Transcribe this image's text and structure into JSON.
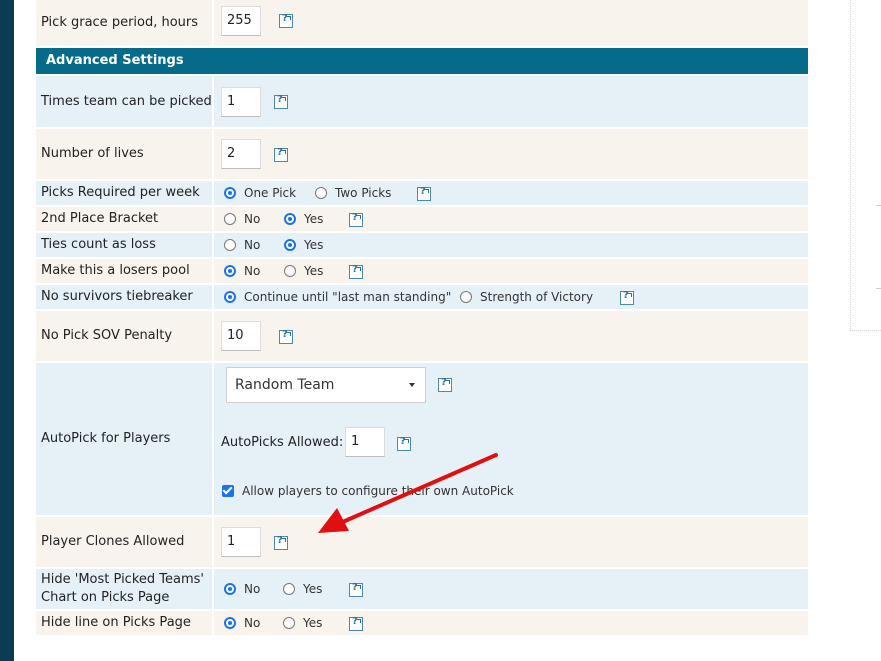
{
  "colors": {
    "section_header": "#066a8a",
    "left_bar": "#0c3c55",
    "row_beige": "#f8f3ec",
    "row_blue": "#e6f1f7",
    "radio_accent": "#1a73e8",
    "arrow": "#e01010"
  },
  "grace": {
    "label": "Pick grace period, hours",
    "value": "255"
  },
  "section": {
    "title": "Advanced Settings"
  },
  "times_picked": {
    "label": "Times team can be picked",
    "value": "1"
  },
  "lives": {
    "label": "Number of lives",
    "value": "2"
  },
  "picks_required": {
    "label": "Picks Required per week",
    "options": [
      "One Pick",
      "Two Picks"
    ],
    "selected": "One Pick"
  },
  "second_place": {
    "label": "2nd Place Bracket",
    "options": [
      "No",
      "Yes"
    ],
    "selected": "Yes"
  },
  "ties_loss": {
    "label": "Ties count as loss",
    "options": [
      "No",
      "Yes"
    ],
    "selected": "Yes"
  },
  "losers_pool": {
    "label": "Make this a losers pool",
    "options": [
      "No",
      "Yes"
    ],
    "selected": "No"
  },
  "no_survivors": {
    "label": "No survivors tiebreaker",
    "options": [
      "Continue until \"last man standing\"",
      "Strength of Victory"
    ],
    "selected": "Continue until \"last man standing\""
  },
  "sov_penalty": {
    "label": "No Pick SOV Penalty",
    "value": "10"
  },
  "autopick": {
    "label": "AutoPick for Players",
    "select_value": "Random Team",
    "allowed_label": "AutoPicks Allowed:",
    "allowed_value": "1",
    "checkbox_label": "Allow players to configure their own AutoPick",
    "checkbox_checked": true
  },
  "clones": {
    "label": "Player Clones Allowed",
    "value": "1"
  },
  "hide_chart": {
    "label": "Hide 'Most Picked Teams' Chart on Picks Page",
    "options": [
      "No",
      "Yes"
    ],
    "selected": "No"
  },
  "hide_line": {
    "label": "Hide line on Picks Page",
    "options": [
      "No",
      "Yes"
    ],
    "selected": "No"
  },
  "icons": {
    "help": "help-icon",
    "arrow": "red-arrow-annotation",
    "dropdown": "chevron-down-icon"
  }
}
